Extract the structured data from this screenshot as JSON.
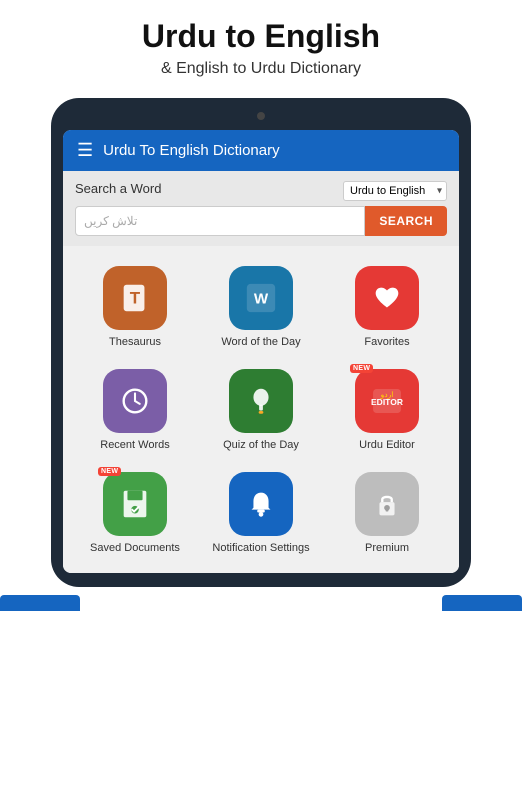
{
  "hero": {
    "title": "Urdu to English",
    "subtitle": "& English to Urdu Dictionary"
  },
  "topbar": {
    "title": "Urdu To English Dictionary",
    "hamburger": "☰"
  },
  "search": {
    "label": "Search a Word",
    "placeholder": "تلاش کریں",
    "button": "SEARCH",
    "lang_option": "Urdu to English"
  },
  "grid_items": [
    {
      "id": "thesaurus",
      "label": "Thesaurus",
      "color_class": "ic-thesaurus",
      "icon": "T",
      "new": false
    },
    {
      "id": "word-of-day",
      "label": "Word of the Day",
      "color_class": "ic-word-day",
      "icon": "W",
      "new": false
    },
    {
      "id": "favorites",
      "label": "Favorites",
      "color_class": "ic-favorites",
      "icon": "♥",
      "new": false
    },
    {
      "id": "recent-words",
      "label": "Recent Words",
      "color_class": "ic-recent",
      "icon": "🕐",
      "new": false
    },
    {
      "id": "quiz-day",
      "label": "Quiz of the Day",
      "color_class": "ic-quiz",
      "icon": "💡",
      "new": false
    },
    {
      "id": "urdu-editor",
      "label": "Urdu Editor",
      "color_class": "ic-urdu-editor",
      "icon": "اردو",
      "new": true
    },
    {
      "id": "saved-docs",
      "label": "Saved Documents",
      "color_class": "ic-saved",
      "icon": "💾",
      "new": true
    },
    {
      "id": "notifications",
      "label": "Notification Settings",
      "color_class": "ic-notification",
      "icon": "🔔",
      "new": false
    },
    {
      "id": "premium",
      "label": "Premium",
      "color_class": "ic-premium",
      "icon": "🔒",
      "new": false
    }
  ]
}
